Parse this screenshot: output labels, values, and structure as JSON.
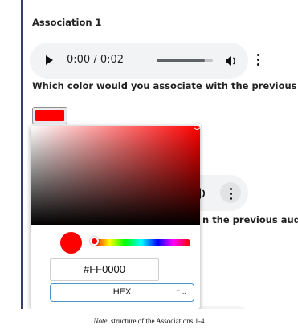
{
  "association": {
    "title": "Association 1",
    "question": "Which color would you associate with the previous audio?"
  },
  "audio_player": {
    "time": "0:00 / 0:02",
    "progress": 0.85,
    "icons": [
      "play-icon",
      "volume-icon",
      "more-options-icon"
    ]
  },
  "partial_question": "n the previous audio?",
  "color_picker": {
    "selected_color": "#ff0000",
    "hex_value": "#FF0000",
    "format": "HEX",
    "hue": 0
  },
  "caption": {
    "prefix": "Note.",
    "text": " structure of the Associations 1-4"
  },
  "colors": {
    "accent_border": "#39406a",
    "select_border": "#4b94ce",
    "audio_bg": "#f1f3f4"
  }
}
